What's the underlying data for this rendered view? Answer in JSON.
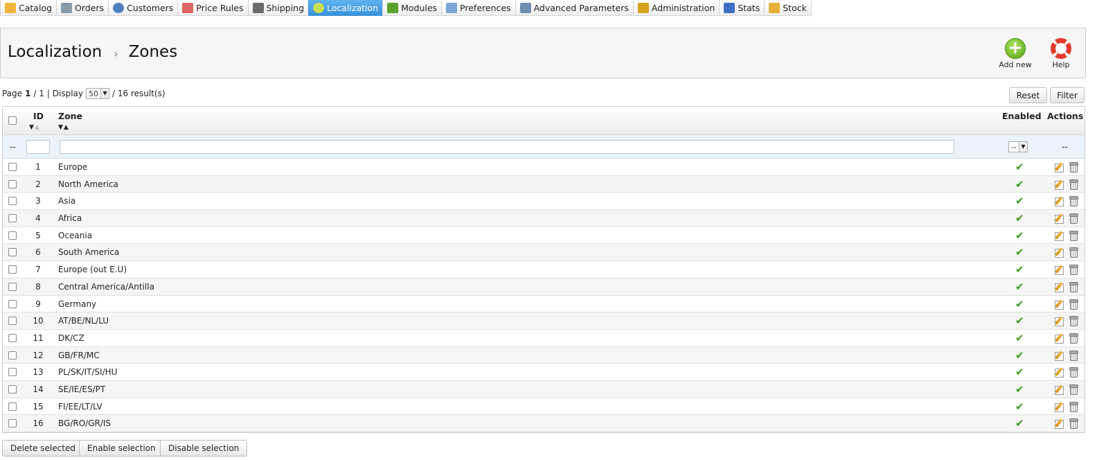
{
  "nav": {
    "tabs": [
      {
        "label": "Catalog",
        "icon": "folder-icon",
        "color": "#f0b53a"
      },
      {
        "label": "Orders",
        "icon": "cart-icon",
        "color": "#8a9aa8"
      },
      {
        "label": "Customers",
        "icon": "user-icon",
        "color": "#4d7fbf"
      },
      {
        "label": "Price Rules",
        "icon": "price-tag-icon",
        "color": "#d55"
      },
      {
        "label": "Shipping",
        "icon": "truck-icon",
        "color": "#6a6a6a"
      },
      {
        "label": "Localization",
        "icon": "globe-icon",
        "color": "#c8dd52",
        "active": true
      },
      {
        "label": "Modules",
        "icon": "puzzle-icon",
        "color": "#5aa12c"
      },
      {
        "label": "Preferences",
        "icon": "preferences-icon",
        "color": "#7ca7d6"
      },
      {
        "label": "Advanced Parameters",
        "icon": "wrench-icon",
        "color": "#6f8fb0"
      },
      {
        "label": "Administration",
        "icon": "key-icon",
        "color": "#d6a21b"
      },
      {
        "label": "Stats",
        "icon": "bar-chart-icon",
        "color": "#3d6fc2"
      },
      {
        "label": "Stock",
        "icon": "stock-icon",
        "color": "#e6b13a"
      }
    ]
  },
  "header": {
    "breadcrumb_parent": "Localization",
    "breadcrumb_sep": "›",
    "title": "Zones",
    "add_new": "Add new",
    "help": "Help"
  },
  "pagination": {
    "page_label": "Page",
    "page": "1",
    "total_pages": "/ 1",
    "display_label": "| Display",
    "per_page": "50",
    "results": "/ 16 result(s)"
  },
  "toolbar": {
    "reset": "Reset",
    "filter": "Filter"
  },
  "table": {
    "col_id": "ID",
    "col_zone": "Zone",
    "col_enabled": "Enabled",
    "col_actions": "Actions",
    "filter_dash": "--",
    "filter_enabled": "--",
    "filter_actions": "--",
    "check_mark": "✔",
    "rows": [
      {
        "id": "1",
        "zone": "Europe"
      },
      {
        "id": "2",
        "zone": "North America"
      },
      {
        "id": "3",
        "zone": "Asia"
      },
      {
        "id": "4",
        "zone": "Africa"
      },
      {
        "id": "5",
        "zone": "Oceania"
      },
      {
        "id": "6",
        "zone": "South America"
      },
      {
        "id": "7",
        "zone": "Europe (out E.U)"
      },
      {
        "id": "8",
        "zone": "Central America/Antilla"
      },
      {
        "id": "9",
        "zone": "Germany"
      },
      {
        "id": "10",
        "zone": "AT/BE/NL/LU"
      },
      {
        "id": "11",
        "zone": "DK/CZ"
      },
      {
        "id": "12",
        "zone": "GB/FR/MC"
      },
      {
        "id": "13",
        "zone": "PL/SK/IT/SI/HU"
      },
      {
        "id": "14",
        "zone": "SE/IE/ES/PT"
      },
      {
        "id": "15",
        "zone": "FI/EE/LT/LV"
      },
      {
        "id": "16",
        "zone": "BG/RO/GR/IS"
      }
    ]
  },
  "bulk": {
    "delete": "Delete selected",
    "enable": "Enable selection",
    "disable": "Disable selection"
  }
}
